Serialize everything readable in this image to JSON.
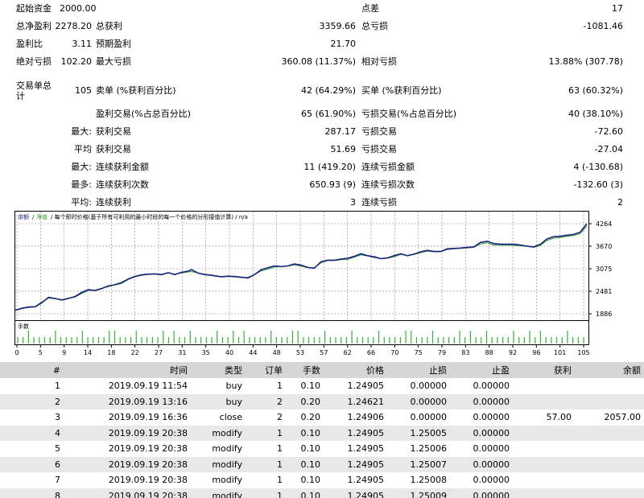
{
  "stats": {
    "r1": {
      "l1": "起始资金",
      "v1": "2000.00",
      "l3": "点差",
      "v3": "17"
    },
    "r2": {
      "l1": "总净盈利",
      "v1": "2278.20",
      "l2": "总获利",
      "v2": "3359.66",
      "l3": "总亏损",
      "v3": "-1081.46"
    },
    "r3": {
      "l1": "盈利比",
      "v1": "3.11",
      "l2": "预期盈利",
      "v2": "21.70"
    },
    "r4": {
      "l1": "绝对亏损",
      "v1": "102.20",
      "l2": "最大亏损",
      "v2": "360.08 (11.37%)",
      "l3": "相对亏损",
      "v3": "13.88% (307.78)"
    },
    "r5": {
      "l1a": "交易单总",
      "l1b": "计",
      "v1": "105",
      "l2": "卖单 (%获利百分比)",
      "v2": "42 (64.29%)",
      "l3": "买单 (%获利百分比)",
      "v3": "63 (60.32%)"
    },
    "r6": {
      "l2": "盈利交易(%占总百分比)",
      "v2": "65 (61.90%)",
      "l3": "亏损交易(%占总百分比)",
      "v3": "40 (38.10%)"
    },
    "r7": {
      "p": "最大:",
      "l2": "获利交易",
      "v2": "287.17",
      "l3": "亏损交易",
      "v3": "-72.60"
    },
    "r8": {
      "p": "平均",
      "l2": "获利交易",
      "v2": "51.69",
      "l3": "亏损交易",
      "v3": "-27.04"
    },
    "r9": {
      "p": "最大:",
      "l2": "连续获利金额",
      "v2": "11 (419.20)",
      "l3": "连续亏损金额",
      "v3": "4 (-130.68)"
    },
    "r10": {
      "p": "最多:",
      "l2": "连续获利次数",
      "v2": "650.93 (9)",
      "l3": "连续亏损次数",
      "v3": "-132.60 (3)"
    },
    "r11": {
      "p": "平均:",
      "l2": "连续获利",
      "v2": "3",
      "l3": "连续亏损",
      "v3": "2"
    }
  },
  "chart_data": {
    "type": "line",
    "legend": {
      "balance": "余额",
      "equity": "净值",
      "text": "/ 每个即时价格(基于所有可利用的最小时段的每一个价格的分形接值计算) / n/a"
    },
    "volume_label": "手数",
    "y_ticks": [
      1886,
      2481,
      3075,
      3670,
      4264
    ],
    "ylim": [
      1886,
      4264
    ],
    "x_ticks": [
      "0",
      "5",
      "9",
      "14",
      "18",
      "22",
      "27",
      "31",
      "35",
      "40",
      "44",
      "48",
      "53",
      "57",
      "62",
      "66",
      "70",
      "75",
      "79",
      "83",
      "88",
      "92",
      "96",
      "101",
      "105"
    ],
    "xlim": [
      0,
      105
    ],
    "colors": {
      "balance": "#1a237e",
      "equity": "#2e9a2e",
      "volume": "#33b533"
    },
    "balance": [
      [
        0,
        1980
      ],
      [
        2,
        2030
      ],
      [
        4,
        2060
      ],
      [
        6,
        2070
      ],
      [
        8,
        2180
      ],
      [
        10,
        2320
      ],
      [
        12,
        2290
      ],
      [
        14,
        2250
      ],
      [
        16,
        2290
      ],
      [
        18,
        2340
      ],
      [
        20,
        2450
      ],
      [
        22,
        2520
      ],
      [
        24,
        2500
      ],
      [
        26,
        2550
      ],
      [
        28,
        2620
      ],
      [
        30,
        2650
      ],
      [
        32,
        2700
      ],
      [
        34,
        2800
      ],
      [
        36,
        2870
      ],
      [
        38,
        2910
      ],
      [
        40,
        2930
      ],
      [
        42,
        2940
      ],
      [
        44,
        2920
      ],
      [
        46,
        2970
      ],
      [
        48,
        2920
      ],
      [
        50,
        2980
      ],
      [
        52,
        3010
      ],
      [
        53,
        3050
      ],
      [
        55,
        2960
      ],
      [
        57,
        2920
      ],
      [
        59,
        2900
      ],
      [
        62,
        2860
      ],
      [
        64,
        2880
      ],
      [
        66,
        2870
      ],
      [
        68,
        2850
      ],
      [
        70,
        2830
      ],
      [
        72,
        2920
      ],
      [
        74,
        3050
      ],
      [
        76,
        3100
      ],
      [
        78,
        3150
      ],
      [
        80,
        3130
      ],
      [
        82,
        3150
      ],
      [
        84,
        3200
      ],
      [
        86,
        3170
      ],
      [
        88,
        3110
      ],
      [
        90,
        3090
      ],
      [
        92,
        3260
      ],
      [
        94,
        3300
      ],
      [
        96,
        3300
      ],
      [
        98,
        3330
      ],
      [
        100,
        3350
      ],
      [
        102,
        3400
      ],
      [
        104,
        3470
      ],
      [
        106,
        3420
      ],
      [
        108,
        3390
      ],
      [
        110,
        3340
      ],
      [
        112,
        3360
      ],
      [
        114,
        3420
      ],
      [
        116,
        3470
      ],
      [
        118,
        3420
      ],
      [
        120,
        3460
      ],
      [
        122,
        3520
      ],
      [
        124,
        3560
      ],
      [
        126,
        3530
      ],
      [
        128,
        3530
      ],
      [
        130,
        3600
      ],
      [
        132,
        3610
      ],
      [
        134,
        3620
      ],
      [
        136,
        3640
      ],
      [
        138,
        3650
      ],
      [
        140,
        3770
      ],
      [
        142,
        3800
      ],
      [
        144,
        3740
      ],
      [
        146,
        3720
      ],
      [
        148,
        3720
      ],
      [
        150,
        3720
      ],
      [
        152,
        3700
      ],
      [
        154,
        3670
      ],
      [
        156,
        3650
      ],
      [
        158,
        3720
      ],
      [
        160,
        3860
      ],
      [
        162,
        3920
      ],
      [
        164,
        3930
      ],
      [
        166,
        3960
      ],
      [
        168,
        3980
      ],
      [
        170,
        4040
      ],
      [
        172,
        4264
      ]
    ],
    "equity": [
      [
        0,
        1980
      ],
      [
        2,
        2040
      ],
      [
        4,
        2070
      ],
      [
        6,
        2080
      ],
      [
        8,
        2200
      ],
      [
        10,
        2300
      ],
      [
        12,
        2280
      ],
      [
        14,
        2260
      ],
      [
        16,
        2300
      ],
      [
        18,
        2330
      ],
      [
        20,
        2420
      ],
      [
        22,
        2500
      ],
      [
        24,
        2510
      ],
      [
        26,
        2560
      ],
      [
        28,
        2600
      ],
      [
        30,
        2660
      ],
      [
        32,
        2720
      ],
      [
        34,
        2810
      ],
      [
        36,
        2880
      ],
      [
        38,
        2920
      ],
      [
        40,
        2940
      ],
      [
        42,
        2930
      ],
      [
        44,
        2910
      ],
      [
        46,
        2960
      ],
      [
        48,
        2930
      ],
      [
        50,
        2960
      ],
      [
        52,
        2990
      ],
      [
        53,
        3000
      ],
      [
        55,
        2960
      ],
      [
        57,
        2930
      ],
      [
        59,
        2910
      ],
      [
        62,
        2870
      ],
      [
        64,
        2870
      ],
      [
        66,
        2860
      ],
      [
        68,
        2840
      ],
      [
        70,
        2850
      ],
      [
        72,
        2920
      ],
      [
        74,
        3020
      ],
      [
        76,
        3060
      ],
      [
        78,
        3120
      ],
      [
        80,
        3130
      ],
      [
        82,
        3140
      ],
      [
        84,
        3180
      ],
      [
        86,
        3140
      ],
      [
        88,
        3100
      ],
      [
        90,
        3100
      ],
      [
        92,
        3230
      ],
      [
        94,
        3290
      ],
      [
        96,
        3290
      ],
      [
        98,
        3310
      ],
      [
        100,
        3320
      ],
      [
        102,
        3380
      ],
      [
        104,
        3440
      ],
      [
        106,
        3410
      ],
      [
        108,
        3370
      ],
      [
        110,
        3340
      ],
      [
        112,
        3350
      ],
      [
        114,
        3390
      ],
      [
        116,
        3450
      ],
      [
        118,
        3420
      ],
      [
        120,
        3450
      ],
      [
        122,
        3500
      ],
      [
        124,
        3540
      ],
      [
        126,
        3520
      ],
      [
        128,
        3520
      ],
      [
        130,
        3580
      ],
      [
        132,
        3600
      ],
      [
        134,
        3610
      ],
      [
        136,
        3620
      ],
      [
        138,
        3640
      ],
      [
        140,
        3730
      ],
      [
        142,
        3760
      ],
      [
        144,
        3700
      ],
      [
        146,
        3700
      ],
      [
        148,
        3700
      ],
      [
        150,
        3690
      ],
      [
        152,
        3680
      ],
      [
        154,
        3660
      ],
      [
        156,
        3640
      ],
      [
        158,
        3690
      ],
      [
        160,
        3820
      ],
      [
        162,
        3880
      ],
      [
        164,
        3900
      ],
      [
        166,
        3930
      ],
      [
        168,
        3950
      ],
      [
        170,
        4000
      ],
      [
        172,
        4200
      ]
    ]
  },
  "table": {
    "headers": [
      "#",
      "时间",
      "类型",
      "订单",
      "手数",
      "价格",
      "止损",
      "止盈",
      "获利",
      "余额"
    ],
    "rows": [
      [
        "1",
        "2019.09.19 11:54",
        "buy",
        "1",
        "0.10",
        "1.24905",
        "0.00000",
        "0.00000",
        "",
        ""
      ],
      [
        "2",
        "2019.09.19 13:16",
        "buy",
        "2",
        "0.20",
        "1.24621",
        "0.00000",
        "0.00000",
        "",
        ""
      ],
      [
        "3",
        "2019.09.19 16:36",
        "close",
        "2",
        "0.20",
        "1.24906",
        "0.00000",
        "0.00000",
        "57.00",
        "2057.00"
      ],
      [
        "4",
        "2019.09.19 20:38",
        "modify",
        "1",
        "0.10",
        "1.24905",
        "1.25005",
        "0.00000",
        "",
        ""
      ],
      [
        "5",
        "2019.09.19 20:38",
        "modify",
        "1",
        "0.10",
        "1.24905",
        "1.25006",
        "0.00000",
        "",
        ""
      ],
      [
        "6",
        "2019.09.19 20:38",
        "modify",
        "1",
        "0.10",
        "1.24905",
        "1.25007",
        "0.00000",
        "",
        ""
      ],
      [
        "7",
        "2019.09.19 20:38",
        "modify",
        "1",
        "0.10",
        "1.24905",
        "1.25008",
        "0.00000",
        "",
        ""
      ],
      [
        "8",
        "2019.09.19 20:38",
        "modify",
        "1",
        "0.10",
        "1.24905",
        "1.25009",
        "0.00000",
        "",
        ""
      ]
    ]
  }
}
